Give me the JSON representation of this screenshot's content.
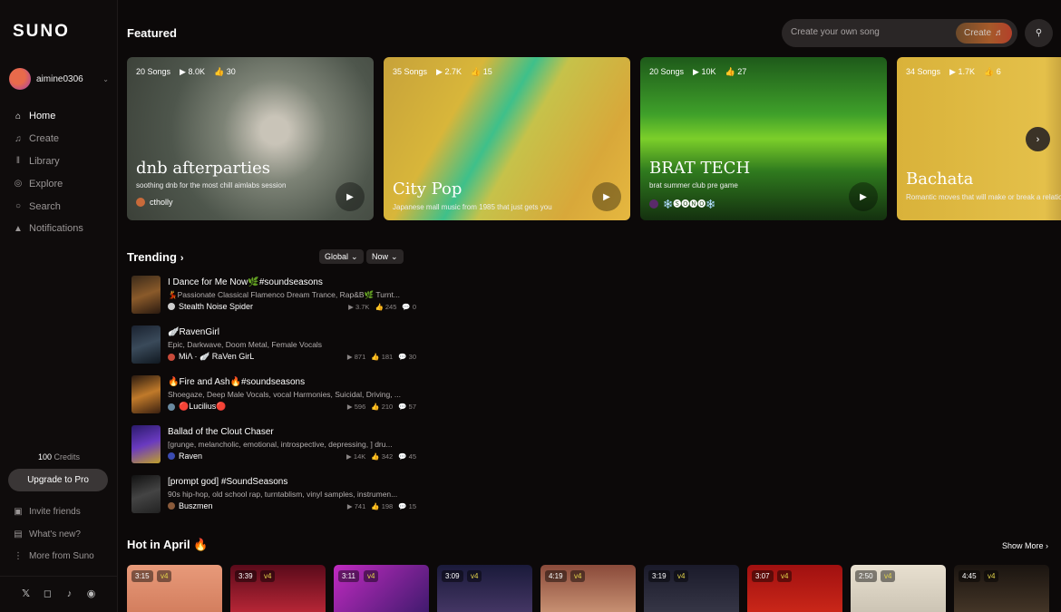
{
  "sidebar": {
    "logo": "SUNO",
    "username": "aimine0306",
    "nav": [
      {
        "label": "Home",
        "icon": "home-icon"
      },
      {
        "label": "Create",
        "icon": "music-note-icon"
      },
      {
        "label": "Library",
        "icon": "library-icon"
      },
      {
        "label": "Explore",
        "icon": "compass-icon"
      },
      {
        "label": "Search",
        "icon": "search-icon"
      },
      {
        "label": "Notifications",
        "icon": "bell-icon"
      }
    ],
    "credits_value": "100",
    "credits_label": "Credits",
    "upgrade_label": "Upgrade to Pro",
    "bottom": [
      {
        "label": "Invite friends",
        "icon": "gift-icon"
      },
      {
        "label": "What's new?",
        "icon": "news-icon"
      },
      {
        "label": "More from Suno",
        "icon": "more-icon"
      }
    ]
  },
  "header": {
    "featured_title": "Featured",
    "create_placeholder": "Create your own song",
    "create_button": "Create"
  },
  "featured": [
    {
      "songs": "20 Songs",
      "plays": "8.0K",
      "likes": "30",
      "title": "dnb afterparties",
      "desc": "soothing dnb for the most chill aimlabs session",
      "author": "ctholly"
    },
    {
      "songs": "35 Songs",
      "plays": "2.7K",
      "likes": "15",
      "title": "City Pop",
      "desc": "Japanese mall music from 1985 that just gets you",
      "author": ""
    },
    {
      "songs": "20 Songs",
      "plays": "10K",
      "likes": "27",
      "title": "BRAT TECH",
      "desc": "brat summer club pre game",
      "author": "❄️🅢🅞🅝🅞❄️"
    },
    {
      "songs": "34 Songs",
      "plays": "1.7K",
      "likes": "6",
      "title": "Bachata",
      "desc": "Romantic moves that will make or break a relationship",
      "author": ""
    }
  ],
  "trending": {
    "title": "Trending",
    "filter_region": "Global",
    "filter_time": "Now",
    "tracks": [
      {
        "title": "I Dance for Me Now🌿#soundseasons",
        "tags": "💃Passionate Classical Flamenco Dream Trance, Rap&B🌿 Turnt...",
        "author": "Stealth Noise Spider",
        "plays": "3.7K",
        "likes": "245",
        "comments": "0",
        "thumb_color": "#8a5a2a"
      },
      {
        "title": "🪽RavenGirl",
        "tags": "Epic, Darkwave, Doom Metal, Female Vocals",
        "author": "MiΛ · 🪽 RaVen GirL",
        "plays": "871",
        "likes": "181",
        "comments": "30",
        "thumb_color": "#2a3a4a"
      },
      {
        "title": "🔥Fire and Ash🔥#soundseasons",
        "tags": "Shoegaze, Deep Male Vocals, vocal Harmonies, Suicidal, Driving, ...",
        "author": "🔴Lucilius🔴",
        "plays": "596",
        "likes": "210",
        "comments": "57",
        "thumb_color": "#a0682a"
      },
      {
        "title": "Ballad of the Clout Chaser",
        "tags": "[grunge, melancholic, emotional, introspective, depressing, ] dru...",
        "author": "Raven",
        "plays": "14K",
        "likes": "342",
        "comments": "45",
        "thumb_color": "#3a2a8a"
      },
      {
        "title": "[prompt god] #SoundSeasons",
        "tags": "90s hip-hop, old school rap, turntablism, vinyl samples, instrumen...",
        "author": "Buszmen",
        "plays": "741",
        "likes": "198",
        "comments": "15",
        "thumb_color": "#2a2a2a"
      }
    ]
  },
  "hot": {
    "title": "Hot in April 🔥",
    "show_more": "Show More",
    "items": [
      {
        "duration": "3:15",
        "version": "v4",
        "color": "#e89a7a"
      },
      {
        "duration": "3:39",
        "version": "v4",
        "color": "#c42a3a"
      },
      {
        "duration": "3:11",
        "version": "v4",
        "color": "#a02aa0"
      },
      {
        "duration": "3:09",
        "version": "v4",
        "color": "#2a2a5a"
      },
      {
        "duration": "4:19",
        "version": "v4",
        "color": "#b06a4a"
      },
      {
        "duration": "3:19",
        "version": "v4",
        "color": "#2a2a3a"
      },
      {
        "duration": "3:07",
        "version": "v4",
        "color": "#b01a1a"
      },
      {
        "duration": "2:50",
        "version": "v4",
        "color": "#d8d0c0"
      },
      {
        "duration": "4:45",
        "version": "v4",
        "color": "#3a2a1a"
      }
    ]
  }
}
